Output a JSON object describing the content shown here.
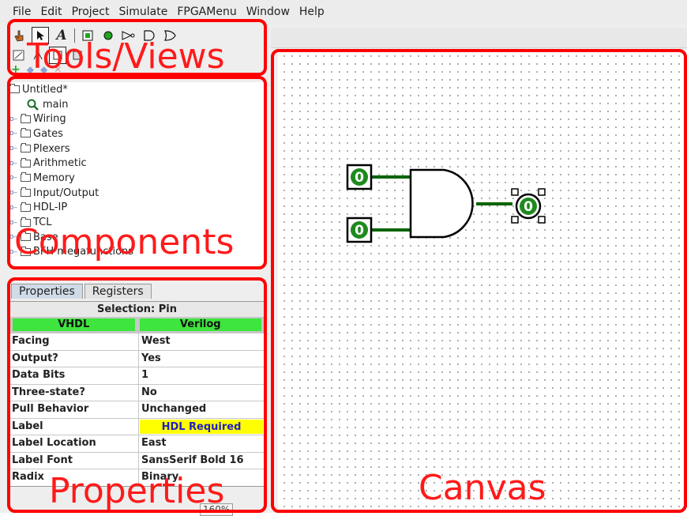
{
  "menubar": {
    "items": [
      "File",
      "Edit",
      "Project",
      "Simulate",
      "FPGAMenu",
      "Window",
      "Help"
    ]
  },
  "toolbar": {
    "tools": [
      {
        "name": "poke-tool-icon",
        "glyph": "✋"
      },
      {
        "name": "select-tool-icon",
        "glyph": "➚"
      },
      {
        "name": "text-tool-icon",
        "glyph": "A"
      },
      {
        "name": "input-pin-icon",
        "glyph": "▣"
      },
      {
        "name": "output-pin-icon",
        "glyph": "●"
      },
      {
        "name": "not-gate-icon",
        "glyph": "▷"
      },
      {
        "name": "and-gate-icon",
        "glyph": "D"
      },
      {
        "name": "or-gate-icon",
        "glyph": "▷"
      }
    ]
  },
  "tree": {
    "root": "Untitled*",
    "main": "main",
    "folders": [
      "Wiring",
      "Gates",
      "Plexers",
      "Arithmetic",
      "Memory",
      "Input/Output",
      "HDL-IP",
      "TCL",
      "Base",
      "BFH megafunctions"
    ]
  },
  "properties": {
    "tabs": [
      "Properties",
      "Registers"
    ],
    "selection": "Selection: Pin",
    "hdl": [
      "VHDL",
      "Verilog"
    ],
    "rows": [
      {
        "key": "Facing",
        "value": "West"
      },
      {
        "key": "Output?",
        "value": "Yes"
      },
      {
        "key": "Data Bits",
        "value": "1"
      },
      {
        "key": "Three-state?",
        "value": "No"
      },
      {
        "key": "Pull Behavior",
        "value": "Unchanged"
      },
      {
        "key": "Label",
        "value": "HDL Required"
      },
      {
        "key": "Label Location",
        "value": "East"
      },
      {
        "key": "Label Font",
        "value": "SansSerif Bold 16"
      },
      {
        "key": "Radix",
        "value": "Binary"
      }
    ],
    "zoom": "160%"
  },
  "canvas": {
    "input_pins": [
      "0",
      "0"
    ],
    "output_pin": "0"
  },
  "annotations": {
    "tools_views": "Tools/Views",
    "components": "Components",
    "properties": "Properties",
    "canvas": "Canvas"
  },
  "colors": {
    "annotation": "#ff0000",
    "wire_active": "#006400",
    "pin_fill": "#1e8a1e",
    "hdl_green": "#3ee53e",
    "label_highlight": "#ffff00"
  }
}
